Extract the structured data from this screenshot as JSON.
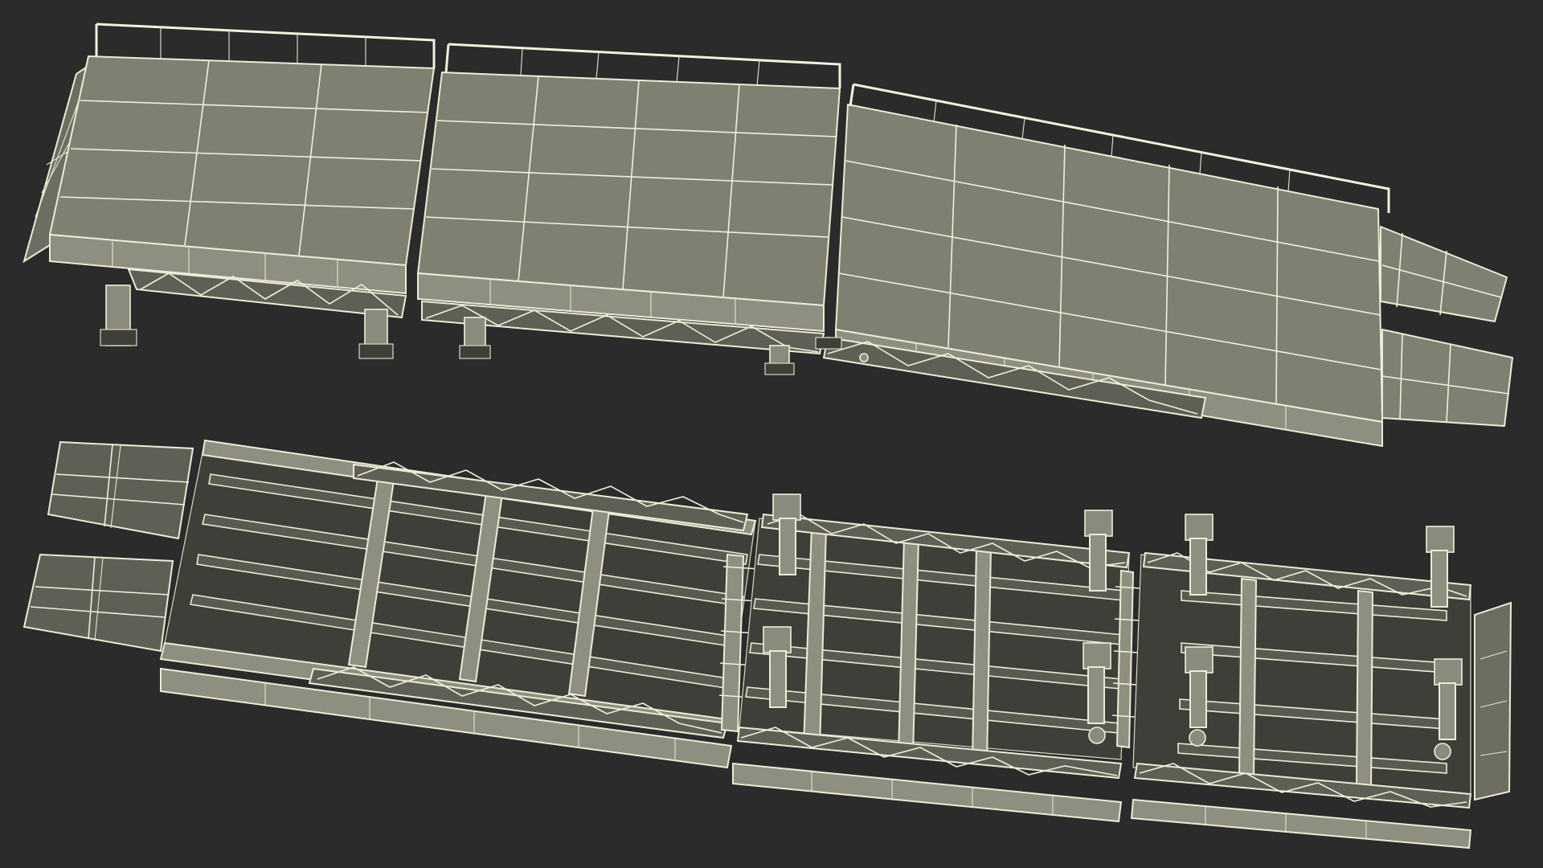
{
  "scene": {
    "background_color": "#2b2b2b",
    "wire_color": "#ecebd7",
    "surface_color": "#7f8072",
    "views": [
      {
        "name": "top-view",
        "sections": 3,
        "description_label": ""
      },
      {
        "name": "bottom-view",
        "sections": 3,
        "description_label": ""
      }
    ]
  }
}
